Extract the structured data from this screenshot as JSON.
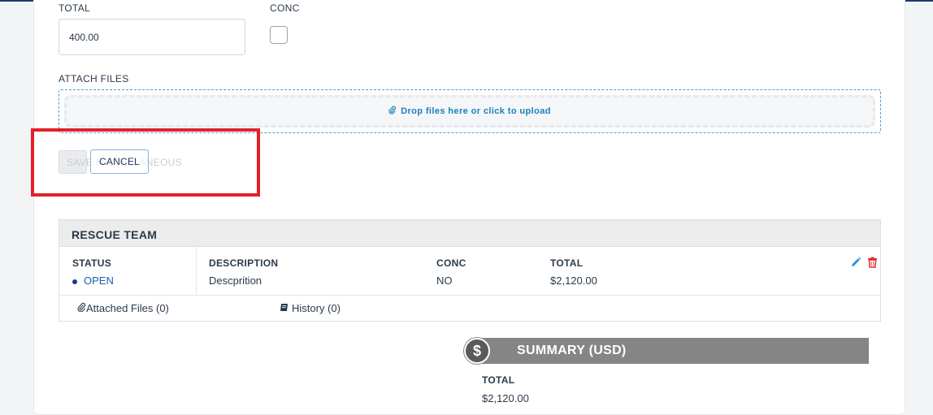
{
  "form": {
    "total_label": "TOTAL",
    "total_value": "400.00",
    "conc_label": "CONC",
    "conc_checked": false,
    "attach_label": "ATTACH FILES",
    "dropzone_text": "Drop files here or click to upload"
  },
  "actions": {
    "save_label": "SAVE MISCELLANEOUS",
    "cancel_label": "CANCEL"
  },
  "rescue_team": {
    "title": "RESCUE TEAM",
    "columns": {
      "status": "STATUS",
      "description": "DESCRIPTION",
      "conc": "CONC",
      "total": "TOTAL"
    },
    "row": {
      "status": "OPEN",
      "description": "Descprition",
      "conc": "NO",
      "total": "$2,120.00"
    },
    "attached_files": "Attached Files (0)",
    "history": "History (0)"
  },
  "summary": {
    "title": "SUMMARY (USD)",
    "icon": "dollar-icon",
    "total_label": "TOTAL",
    "total_value": "$2,120.00"
  },
  "colors": {
    "accent": "#1b3a6b",
    "highlight": "#e3202a",
    "link": "#1a7fc0",
    "delete": "#e02b2b",
    "summary_bar": "#858585"
  }
}
